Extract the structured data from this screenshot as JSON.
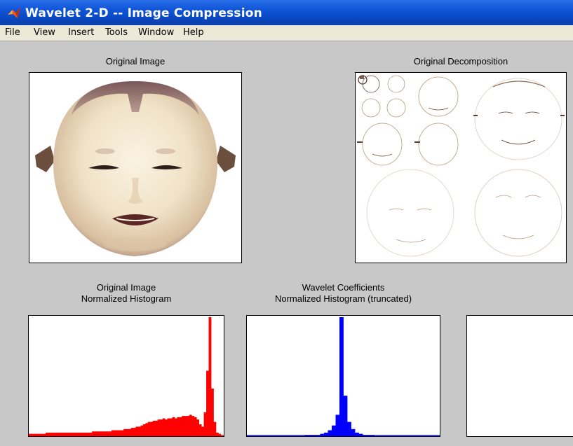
{
  "window": {
    "title": "Wavelet 2-D -- Image Compression",
    "icon": "matlab-icon"
  },
  "menu": {
    "items": [
      "File",
      "View",
      "Insert",
      "Tools",
      "Window",
      "Help"
    ]
  },
  "panels": {
    "original_image": {
      "title": "Original Image"
    },
    "original_decomposition": {
      "title": "Original Decomposition"
    },
    "histogram_original": {
      "title_line1": "Original Image",
      "title_line2": "Normalized Histogram"
    },
    "histogram_coefficients": {
      "title_line1": "Wavelet Coefficients",
      "title_line2": "Normalized Histogram (truncated)"
    }
  },
  "colors": {
    "titlebar": "#0a48c4",
    "background": "#c8c8c8",
    "hist_original": "#ff0000",
    "hist_coefficients": "#0000ff",
    "mask_skin": "#f2e7cf"
  },
  "chart_data": [
    {
      "type": "bar",
      "values": [
        2,
        2,
        2,
        2,
        2,
        2,
        2,
        3,
        3,
        3,
        3,
        3,
        3,
        3,
        3,
        3,
        3,
        3,
        3,
        3,
        3,
        3,
        3,
        3,
        3,
        3,
        4,
        4,
        4,
        4,
        4,
        4,
        4,
        4,
        5,
        5,
        5,
        5,
        5,
        6,
        6,
        6,
        7,
        7,
        8,
        8,
        9,
        10,
        11,
        12,
        12,
        13,
        13,
        14,
        14,
        15,
        14,
        15,
        15,
        16,
        15,
        16,
        16,
        17,
        17,
        17,
        18,
        17,
        16,
        14,
        10,
        8,
        20,
        55,
        100,
        40,
        12,
        3,
        2
      ],
      "xlim": [
        0,
        1
      ],
      "ylim": [
        0,
        100
      ]
    },
    {
      "type": "bar",
      "values": [
        0,
        0,
        0,
        0,
        0,
        0,
        0,
        0,
        0,
        0,
        0,
        0,
        0,
        0,
        0,
        1,
        1,
        1,
        1,
        2,
        3,
        5,
        9,
        18,
        100,
        34,
        12,
        6,
        3,
        2,
        1,
        1,
        1,
        0,
        0,
        0,
        0,
        0,
        0,
        0,
        0,
        0,
        0,
        0,
        0,
        0,
        0,
        0,
        0,
        0
      ],
      "xlim": [
        0,
        1
      ],
      "ylim": [
        0,
        100
      ]
    }
  ]
}
